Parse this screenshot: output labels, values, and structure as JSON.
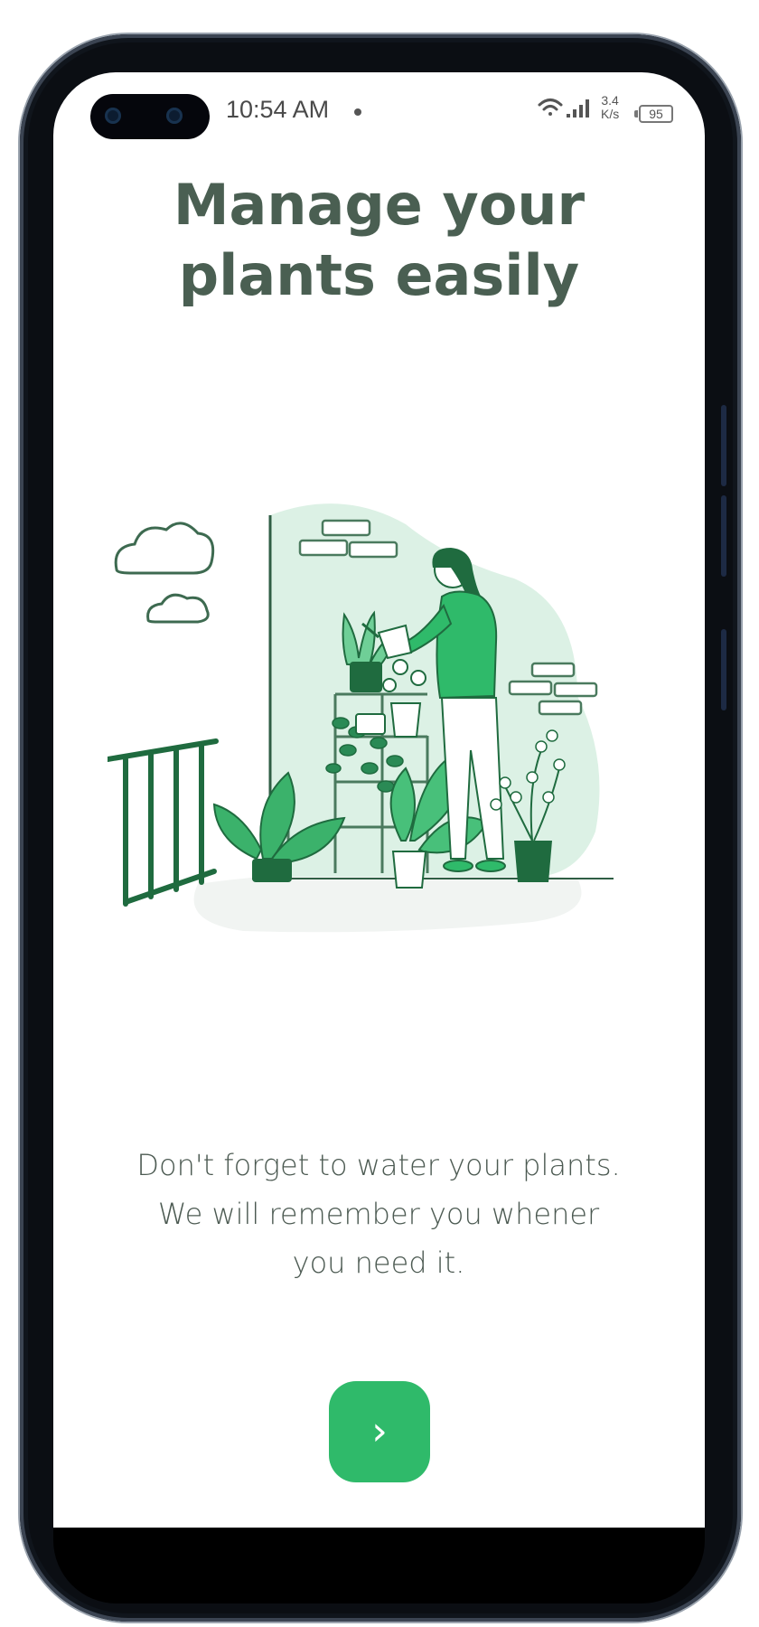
{
  "status_bar": {
    "time": "10:54 AM",
    "network_speed_value": "3.4",
    "network_speed_unit": "K/s",
    "battery_level": "95",
    "icons": [
      "wifi-icon",
      "signal-icon",
      "battery-icon"
    ]
  },
  "onboarding": {
    "title_line1": "Manage your",
    "title_line2": "plants easily",
    "subtitle_line1": "Don't forget to water your plants.",
    "subtitle_line2": "We will remember you whener",
    "subtitle_line3": "you need it.",
    "illustration": "woman-watering-plants-illustration",
    "next_button_icon": "chevron-right-icon",
    "next_button_symbol": "›"
  },
  "colors": {
    "accent": "#2fba6a",
    "title_text": "#4a5f52",
    "body_text": "#4c5a52",
    "illustration_dark": "#1f6b3f",
    "illustration_light": "#d9f1e4"
  }
}
